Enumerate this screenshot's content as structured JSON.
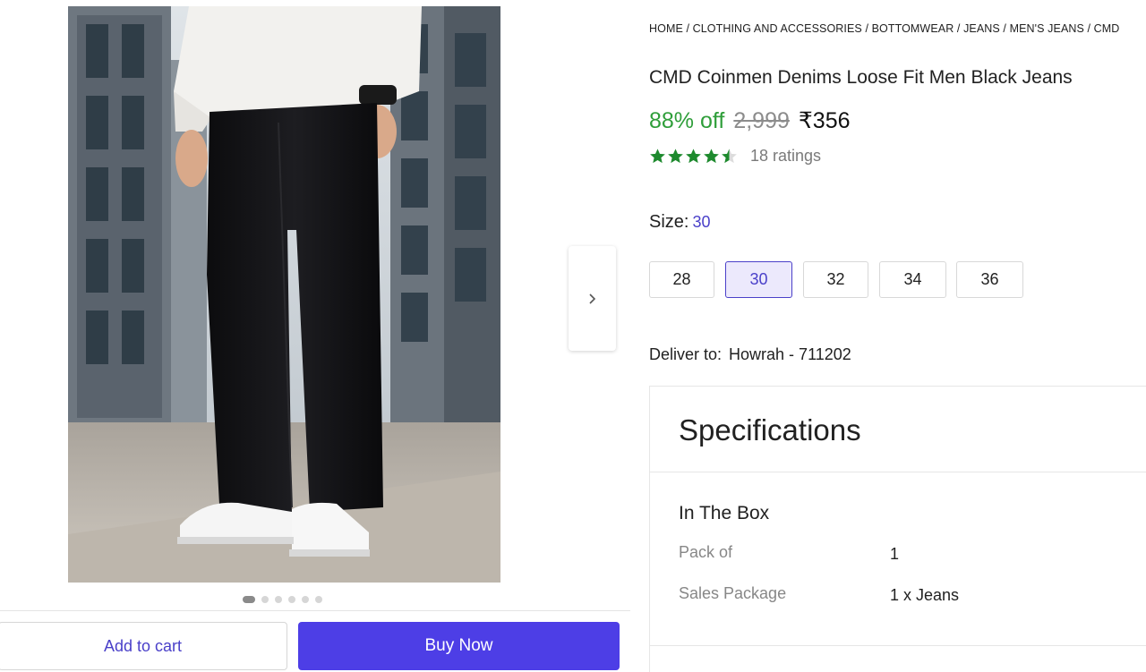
{
  "breadcrumb": [
    "HOME",
    "CLOTHING AND ACCESSORIES",
    "BOTTOMWEAR",
    "JEANS",
    "MEN'S JEANS",
    "CMD"
  ],
  "product": {
    "title": "CMD Coinmen Denims Loose Fit Men Black Jeans",
    "discount": "88% off",
    "mrp": "2,999",
    "price": "₹356",
    "rating": 4.5,
    "ratings_count": "18 ratings"
  },
  "size": {
    "label": "Size:",
    "selected": "30",
    "options": [
      "28",
      "30",
      "32",
      "34",
      "36"
    ]
  },
  "delivery": {
    "label": "Deliver to:",
    "location": "Howrah - 711202"
  },
  "carousel": {
    "count": 6,
    "active_index": 0
  },
  "actions": {
    "add_to_cart": "Add to cart",
    "buy_now": "Buy Now"
  },
  "specifications": {
    "title": "Specifications",
    "section": "In The Box",
    "rows": [
      {
        "key": "Pack of",
        "value": "1"
      },
      {
        "key": "Sales Package",
        "value": "1 x Jeans"
      }
    ]
  },
  "colors": {
    "accent": "#4d3ee6",
    "discount": "#2f9e3a",
    "star": "#1e8a2e"
  },
  "icons": {
    "next_arrow": "chevron-right-icon",
    "rating_star": "star-icon"
  }
}
